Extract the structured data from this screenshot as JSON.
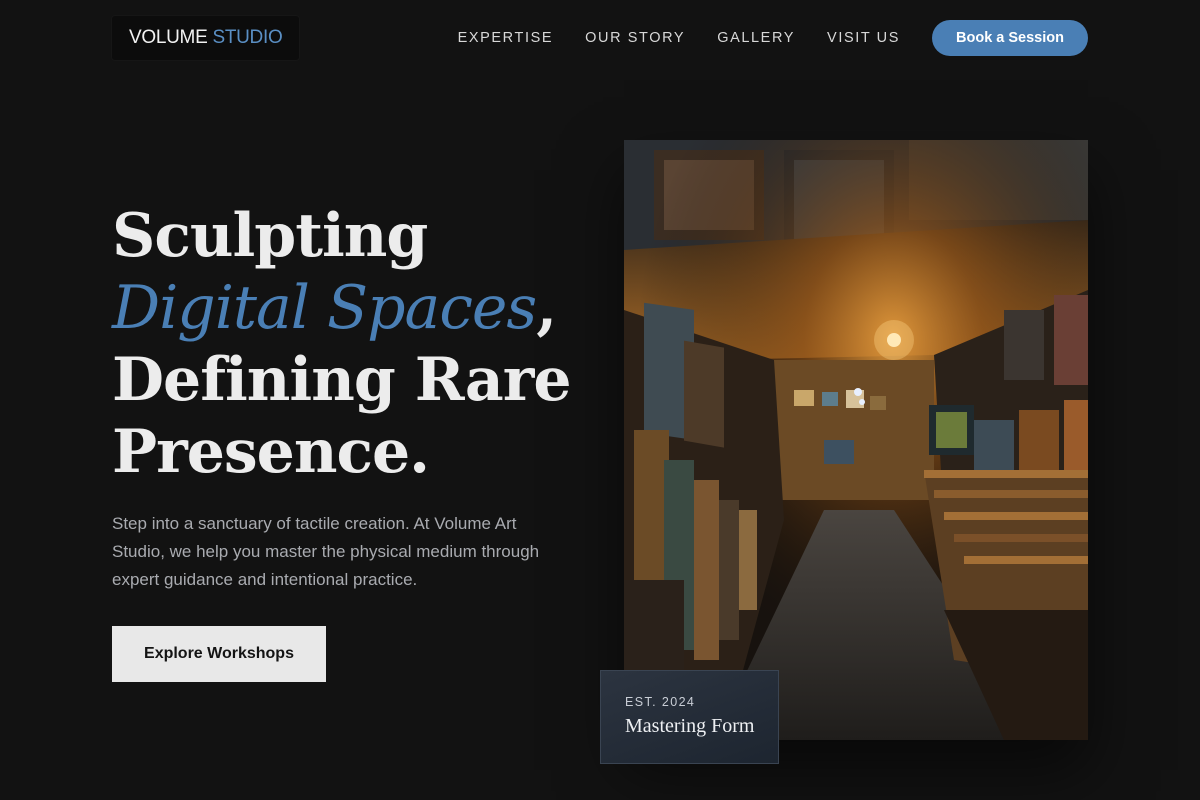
{
  "brand": {
    "word1": "VOLUME",
    "word2": "STUDIO"
  },
  "nav": {
    "links": [
      "EXPERTISE",
      "OUR STORY",
      "GALLERY",
      "VISIT US"
    ],
    "cta": "Book a Session"
  },
  "hero": {
    "line1": "Sculpting",
    "line2_accent": "Digital Spaces",
    "line2_tail": ",",
    "line3": "Defining Rare",
    "line4": "Presence.",
    "body": "Step into a sanctuary of tactile creation. At Volume Art Studio, we help you master the physical medium through expert guidance and intentional practice.",
    "button": "Explore Workshops"
  },
  "badge": {
    "eyebrow": "EST. 2024",
    "title": "Mastering Form"
  },
  "colors": {
    "accent": "#4a7fb5",
    "background": "#121212"
  },
  "image": {
    "subject": "art-gallery-corridor-photo"
  }
}
